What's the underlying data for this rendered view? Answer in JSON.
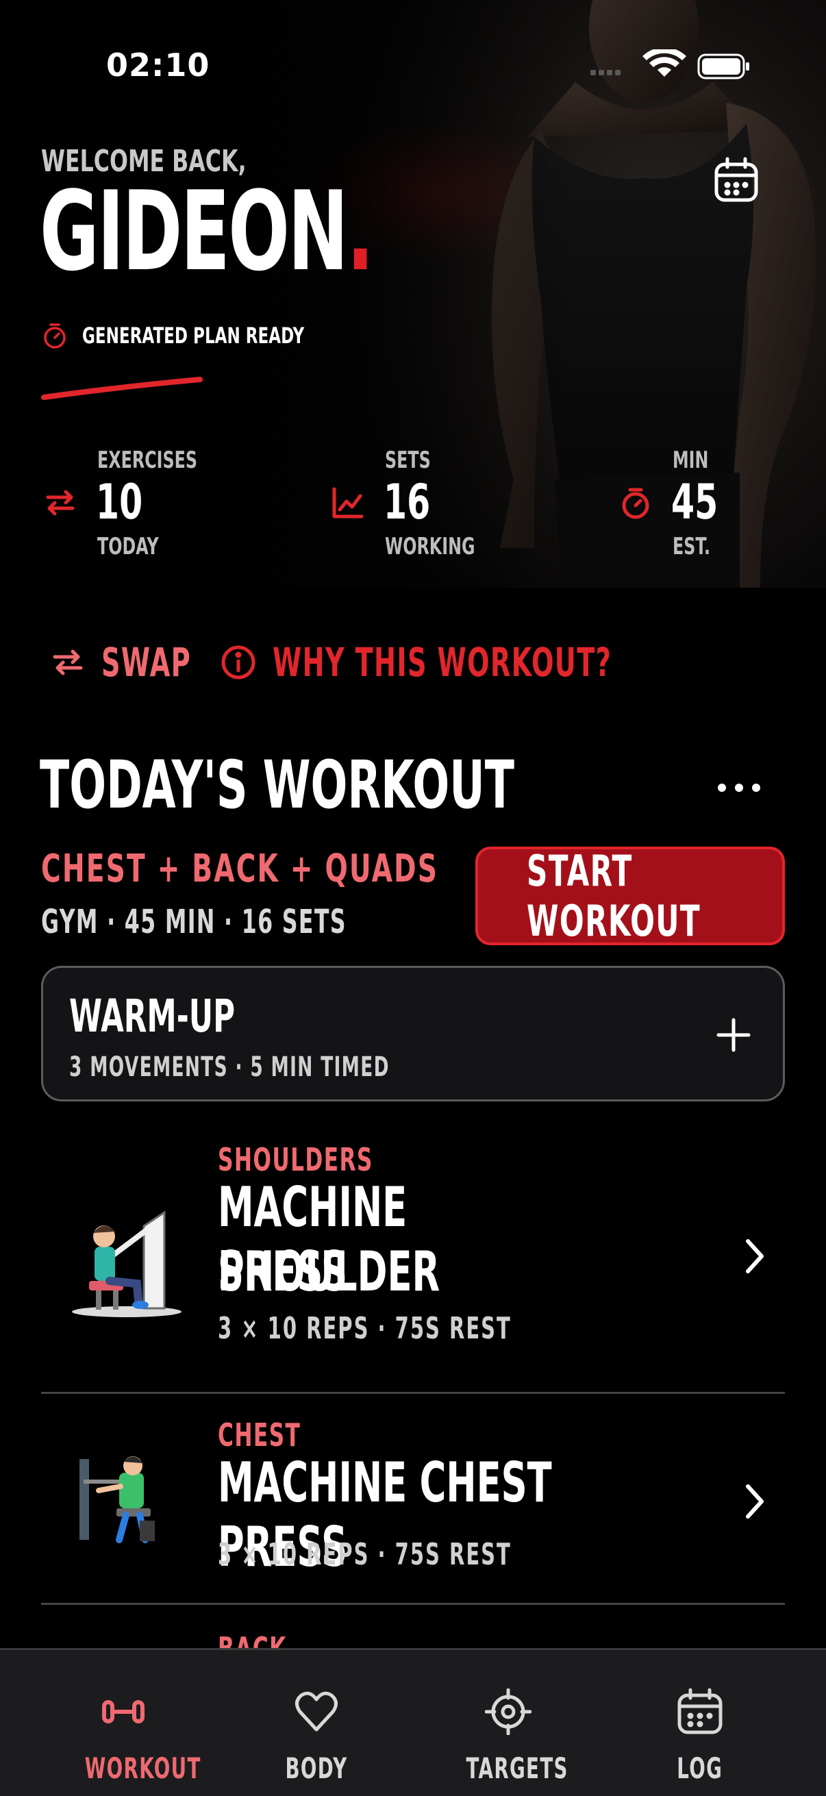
{
  "status_bar": {
    "time": "02:10"
  },
  "header": {
    "welcome": "WELCOME BACK,",
    "name": "GIDEON",
    "name_dot": ".",
    "plan_status": "GENERATED PLAN READY"
  },
  "stats": [
    {
      "label": "EXERCISES",
      "value": "10",
      "sub": "TODAY",
      "icon": "swap-arrows-icon"
    },
    {
      "label": "SETS",
      "value": "16",
      "sub": "WORKING",
      "icon": "chart-line-icon"
    },
    {
      "label": "MIN",
      "value": "45",
      "sub": "EST.",
      "icon": "stopwatch-icon"
    }
  ],
  "actions": {
    "swap": "SWAP",
    "why": "WHY THIS WORKOUT?"
  },
  "workout": {
    "title": "TODAY'S WORKOUT",
    "split": "CHEST + BACK + QUADS",
    "meta": "GYM · 45 MIN · 16 SETS",
    "start_label": "START WORKOUT",
    "warmup": {
      "title": "WARM-UP",
      "subtitle": "3 MOVEMENTS · 5 MIN TIMED"
    },
    "exercises": [
      {
        "muscle": "SHOULDERS",
        "name_line1": "MACHINE SHOULDER",
        "name_line2": "PRESS",
        "detail": "3 × 10 REPS · 75S REST"
      },
      {
        "muscle": "CHEST",
        "name_line1": "MACHINE CHEST PRESS",
        "detail": "3 × 10 REPS · 75S REST"
      },
      {
        "muscle": "BACK"
      }
    ]
  },
  "tabs": [
    {
      "label": "WORKOUT",
      "icon": "dumbbell-icon",
      "active": true
    },
    {
      "label": "BODY",
      "icon": "heart-icon",
      "active": false
    },
    {
      "label": "TARGETS",
      "icon": "target-icon",
      "active": false
    },
    {
      "label": "LOG",
      "icon": "calendar-icon",
      "active": false
    }
  ],
  "colors": {
    "accent": "#e1262c",
    "accent_soft": "#ef6a70",
    "button": "#a4101a",
    "background": "#000000",
    "tabbar": "#1c1c1e"
  }
}
